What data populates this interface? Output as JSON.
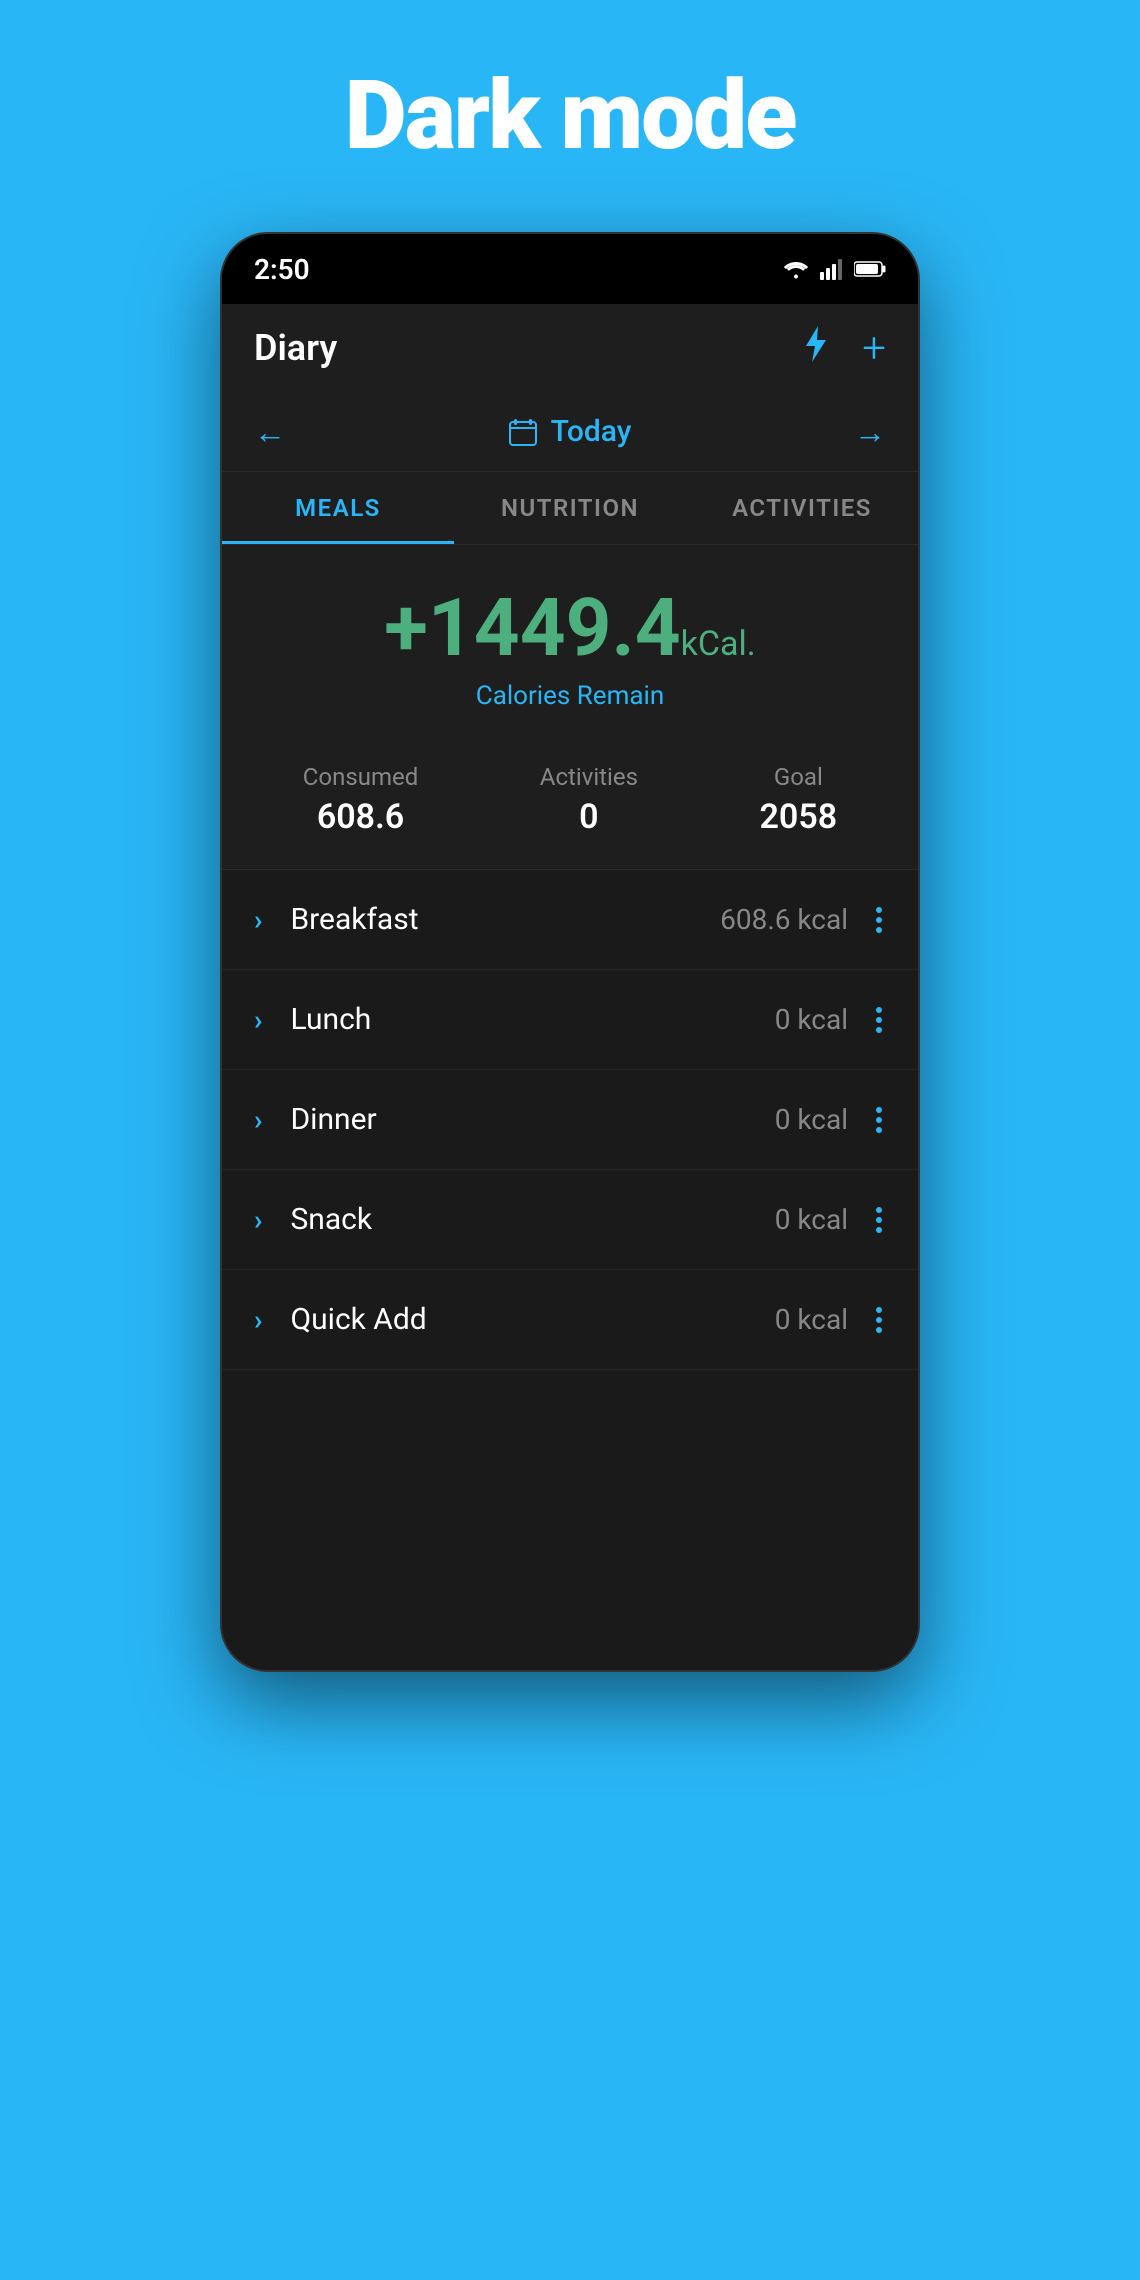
{
  "page": {
    "background_color": "#29b6f6",
    "title": "Dark mode"
  },
  "status_bar": {
    "time": "2:50",
    "wifi_icon": "wifi",
    "signal_icon": "signal",
    "battery_icon": "battery"
  },
  "app_bar": {
    "title": "Diary",
    "lightning_icon": "lightning",
    "add_icon": "+"
  },
  "date_nav": {
    "prev_label": "←",
    "next_label": "→",
    "calendar_icon": "calendar",
    "date_label": "Today"
  },
  "tabs": [
    {
      "id": "meals",
      "label": "MEALS",
      "active": true
    },
    {
      "id": "nutrition",
      "label": "NUTRITION",
      "active": false
    },
    {
      "id": "activities",
      "label": "ACTIVITIES",
      "active": false
    }
  ],
  "calories": {
    "remain_value": "+1449.4",
    "remain_unit": "kCal.",
    "remain_label": "Calories Remain"
  },
  "stats": {
    "consumed_label": "Consumed",
    "consumed_value": "608.6",
    "activities_label": "Activities",
    "activities_value": "0",
    "goal_label": "Goal",
    "goal_value": "2058"
  },
  "meals": [
    {
      "name": "Breakfast",
      "kcal": "608.6 kcal"
    },
    {
      "name": "Lunch",
      "kcal": "0 kcal"
    },
    {
      "name": "Dinner",
      "kcal": "0 kcal"
    },
    {
      "name": "Snack",
      "kcal": "0 kcal"
    },
    {
      "name": "Quick Add",
      "kcal": "0 kcal"
    }
  ],
  "colors": {
    "accent": "#29b6f6",
    "positive": "#4caf7d",
    "text_primary": "#ffffff",
    "text_secondary": "#888888",
    "bg_app": "#1e1e1e",
    "bg_page": "#1a1a1a",
    "bg_status": "#000000"
  }
}
